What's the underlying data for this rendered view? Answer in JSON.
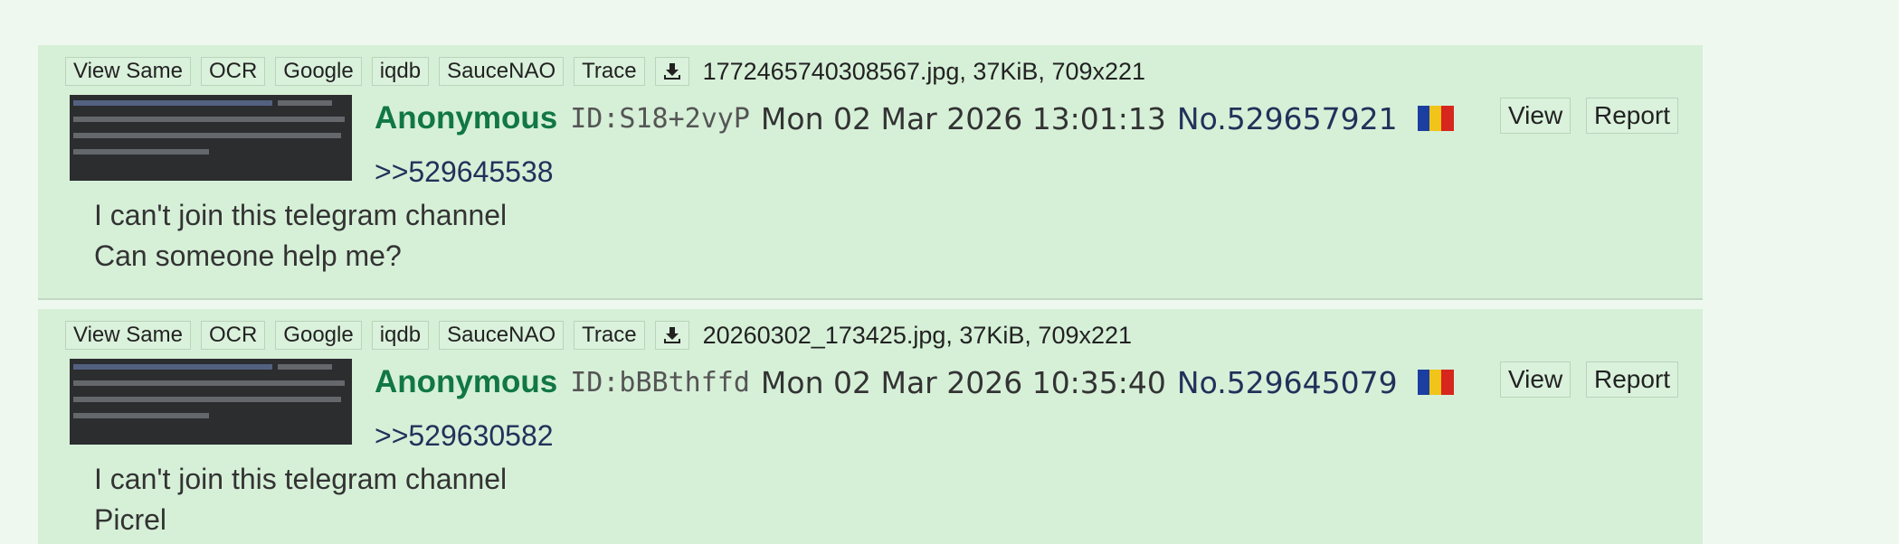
{
  "toolbar": {
    "view_same": "View Same",
    "ocr": "OCR",
    "google": "Google",
    "iqdb": "iqdb",
    "saucenao": "SauceNAO",
    "trace": "Trace",
    "download_icon": "download-icon"
  },
  "flag_colors": [
    "#1b3fa0",
    "#f0c419",
    "#d7261e"
  ],
  "colors": {
    "background": "#eef8ee",
    "post_background": "#d6f0d8",
    "name": "#117743",
    "link": "#24305a"
  },
  "posts": [
    {
      "file_info": "1772465740308567.jpg, 37KiB, 709x221",
      "name": "Anonymous",
      "id": "ID:S18+2vyP",
      "datetime": "Mon 02 Mar 2026 13:01:13",
      "number": "No.529657921",
      "view_label": "View",
      "report_label": "Report",
      "quote": ">>529645538",
      "lines": [
        "I can't join this telegram channel",
        "Can someone help me?"
      ]
    },
    {
      "file_info": "20260302_173425.jpg, 37KiB, 709x221",
      "name": "Anonymous",
      "id": "ID:bBBthffd",
      "datetime": "Mon 02 Mar 2026 10:35:40",
      "number": "No.529645079",
      "view_label": "View",
      "report_label": "Report",
      "quote": ">>529630582",
      "lines": [
        "I can't join this telegram channel",
        "Picrel"
      ]
    }
  ]
}
